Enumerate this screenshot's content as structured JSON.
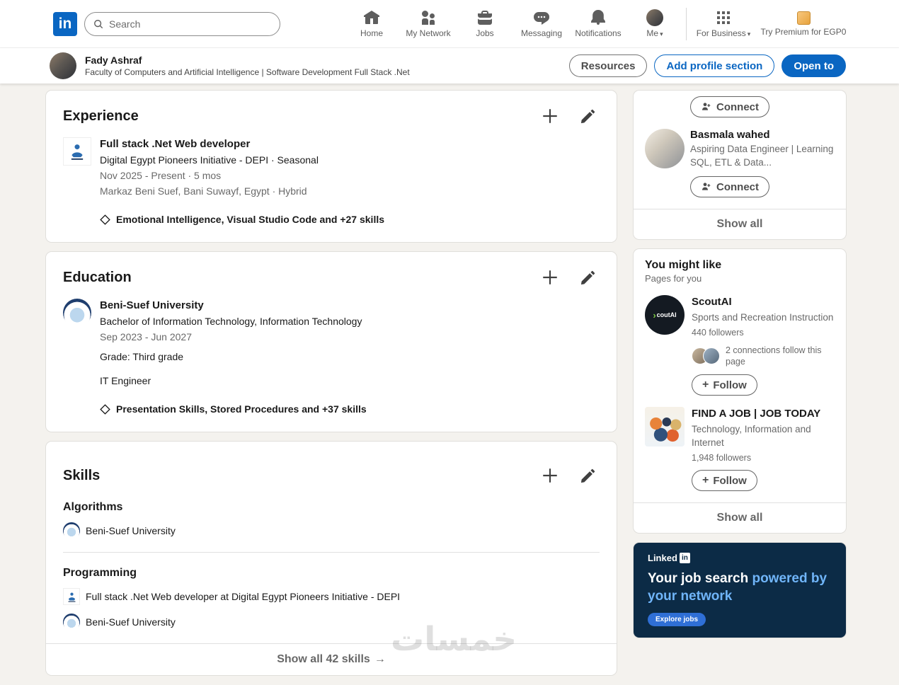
{
  "icons": {
    "plus": "+",
    "caret_down": "▾",
    "arrow_right": "→",
    "chevron_mark": "›"
  },
  "topnav": {
    "logo_text": "in",
    "search_placeholder": "Search",
    "items": [
      {
        "label": "Home"
      },
      {
        "label": "My Network"
      },
      {
        "label": "Jobs"
      },
      {
        "label": "Messaging"
      },
      {
        "label": "Notifications"
      },
      {
        "label": "Me"
      }
    ],
    "for_business_label": "For Business",
    "premium_label": "Try Premium for EGP0"
  },
  "profile_header": {
    "name": "Fady Ashraf",
    "headline": "Faculty of Computers and Artificial Intelligence | Software Development Full Stack .Net",
    "resources_label": "Resources",
    "add_profile_label": "Add profile section",
    "open_to_label": "Open to"
  },
  "experience": {
    "title": "Experience",
    "entry": {
      "role": "Full stack .Net Web developer",
      "org": "Digital Egypt Pioneers Initiative - DEPI · Seasonal",
      "dates": "Nov 2025 - Present · 5 mos",
      "location": "Markaz Beni Suef, Bani Suwayf, Egypt · Hybrid",
      "skills": "Emotional Intelligence, Visual Studio Code and +27 skills"
    }
  },
  "education": {
    "title": "Education",
    "entry": {
      "school": "Beni-Suef University",
      "degree": "Bachelor of Information Technology, Information Technology",
      "dates": "Sep 2023 - Jun 2027",
      "grade": "Grade: Third grade",
      "description": "IT Engineer",
      "skills": "Presentation Skills, Stored Procedures and +37 skills"
    }
  },
  "skills": {
    "title": "Skills",
    "groups": [
      {
        "name": "Algorithms",
        "items": [
          {
            "text": "Beni-Suef University"
          }
        ]
      },
      {
        "name": "Programming",
        "items": [
          {
            "text": "Full stack .Net Web developer at Digital Egypt Pioneers Initiative - DEPI"
          },
          {
            "text": "Beni-Suef University"
          }
        ]
      }
    ],
    "show_all_label": "Show all 42 skills"
  },
  "aside": {
    "people_card": {
      "top_connect_label": "Connect",
      "person": {
        "name": "Basmala wahed",
        "headline": "Aspiring Data Engineer | Learning SQL, ETL & Data...",
        "connect_label": "Connect"
      },
      "show_all_label": "Show all"
    },
    "you_might_like": {
      "title": "You might like",
      "subtitle": "Pages for you",
      "pages": [
        {
          "name": "ScoutAI",
          "logo_text": "coutAI",
          "category": "Sports and Recreation Instruction",
          "followers": "440 followers",
          "social_proof": "2 connections follow this page",
          "follow_label": "Follow"
        },
        {
          "name": "FIND A JOB | JOB TODAY",
          "category": "Technology, Information and Internet",
          "followers": "1,948 followers",
          "follow_label": "Follow"
        }
      ],
      "show_all_label": "Show all"
    },
    "ad": {
      "brand_text": "Linked",
      "brand_in": "in",
      "headline_white": "Your job search",
      "headline_blue": "powered by your network",
      "cta_label": "Explore jobs"
    }
  },
  "watermark": "خمسات",
  "colors": {
    "brand_blue": "#0a66c2",
    "ad_navy": "#0c2b46",
    "ad_link_blue": "#70b5f9",
    "premium_gold": "#e7a33e",
    "background": "#f4f2ee"
  }
}
